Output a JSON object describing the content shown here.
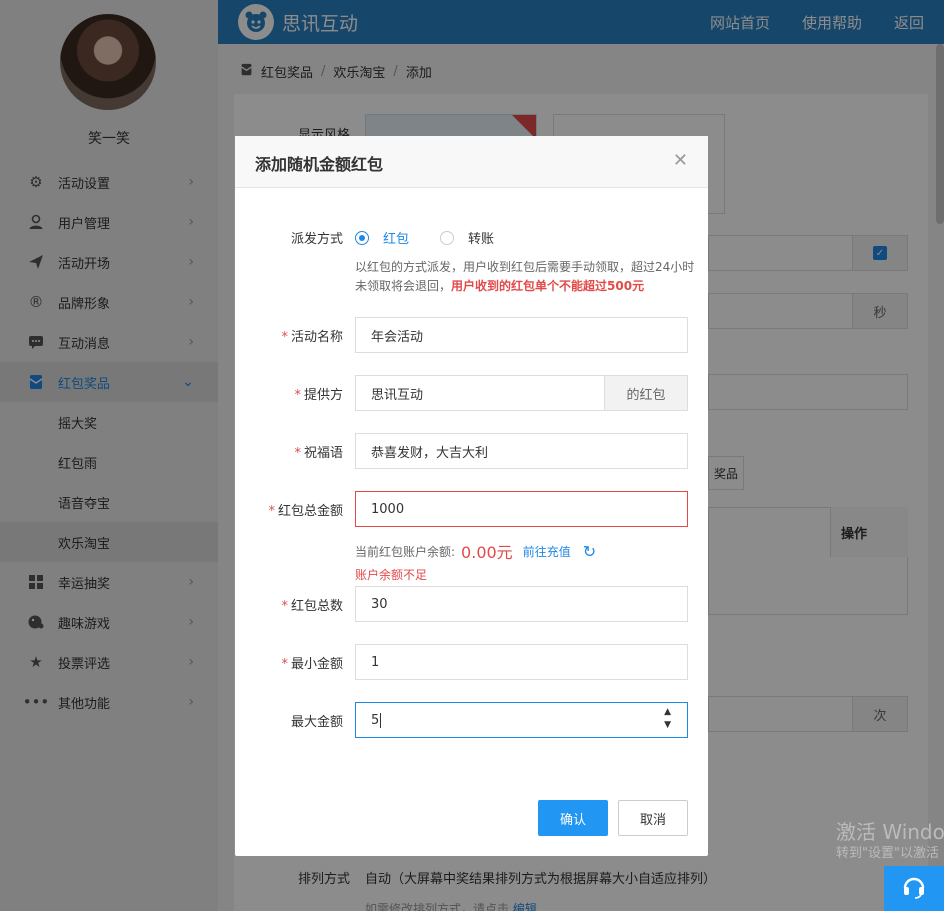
{
  "user": {
    "name": "笑一笑"
  },
  "sidebar": {
    "items": [
      {
        "label": "活动设置",
        "icon": "gears-icon"
      },
      {
        "label": "用户管理",
        "icon": "user-icon"
      },
      {
        "label": "活动开场",
        "icon": "paper-plane-icon"
      },
      {
        "label": "品牌形象",
        "icon": "registered-icon"
      },
      {
        "label": "互动消息",
        "icon": "message-icon"
      },
      {
        "label": "红包奖品",
        "icon": "red-envelope-icon",
        "active": true
      },
      {
        "label": "幸运抽奖",
        "icon": "lottery-icon"
      },
      {
        "label": "趣味游戏",
        "icon": "game-icon"
      },
      {
        "label": "投票评选",
        "icon": "star-icon"
      },
      {
        "label": "其他功能",
        "icon": "more-icon"
      }
    ],
    "submenu": [
      "摇大奖",
      "红包雨",
      "语音夺宝",
      "欢乐淘宝"
    ]
  },
  "topbar": {
    "brand": "思讯互动",
    "nav": [
      "网站首页",
      "使用帮助",
      "返回"
    ]
  },
  "breadcrumb": [
    "红包奖品",
    "欢乐淘宝",
    "添加"
  ],
  "background": {
    "style_label": "显示风格",
    "seconds_addon": "秒",
    "prize_button": "奖品",
    "ops_header": "操作",
    "times_addon": "次",
    "sort_label": "排列方式",
    "sort_value": "自动（大屏幕中奖结果排列方式为根据屏幕大小自适应排列）",
    "sort_hint": "如需修改排列方式，请点击",
    "sort_edit": "编辑"
  },
  "modal": {
    "title": "添加随机金额红包",
    "distribution": {
      "label": "派发方式",
      "options": [
        "红包",
        "转账"
      ],
      "selected": "红包",
      "help_text": "以红包的方式派发，用户收到红包后需要手动领取，超过24小时未领取将会退回，",
      "help_warn": "用户收到的红包单个不能超过500元"
    },
    "fields": {
      "activity_name": {
        "label": "活动名称",
        "value": "年会活动"
      },
      "provider": {
        "label": "提供方",
        "value": "思讯互动",
        "addon": "的红包"
      },
      "greeting": {
        "label": "祝福语",
        "value": "恭喜发财，大吉大利"
      },
      "total_amount": {
        "label": "红包总金额",
        "value": "1000"
      },
      "total_count": {
        "label": "红包总数",
        "value": "30"
      },
      "min_amount": {
        "label": "最小金额",
        "value": "1"
      },
      "max_amount": {
        "label": "最大金额",
        "value": "5"
      }
    },
    "balance": {
      "label": "当前红包账户余额:",
      "value": "0.00元",
      "recharge": "前往充值",
      "error": "账户余额不足"
    },
    "confirm": "确认",
    "cancel": "取消"
  },
  "watermark": {
    "line1": "激活 Windo",
    "line2": "转到\"设置\"以激活"
  }
}
